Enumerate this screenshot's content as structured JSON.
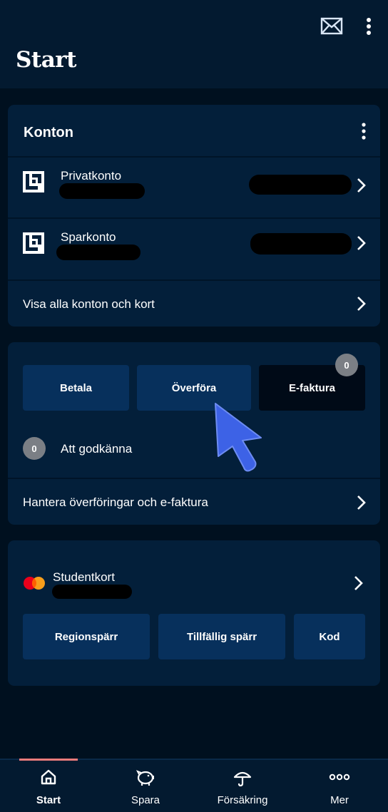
{
  "header": {
    "title": "Start",
    "mail_icon": "mail-icon",
    "more_icon": "more-vertical-icon"
  },
  "accounts_card": {
    "title": "Konton",
    "menu_icon": "more-vertical-icon",
    "accounts": [
      {
        "name": "Privatkonto",
        "icon": "bank-logo-icon"
      },
      {
        "name": "Sparkonto",
        "icon": "bank-logo-icon"
      }
    ],
    "show_all_label": "Visa alla konton och kort"
  },
  "payments_card": {
    "buttons": [
      {
        "label": "Betala"
      },
      {
        "label": "Överföra"
      },
      {
        "label": "E-faktura",
        "badge": "0"
      }
    ],
    "approve_badge": "0",
    "approve_label": "Att godkänna",
    "manage_label": "Hantera överföringar och e-faktura"
  },
  "card_section": {
    "card_name": "Studentkort",
    "card_icon": "mastercard-icon",
    "buttons": [
      {
        "label": "Regionspärr"
      },
      {
        "label": "Tillfällig spärr"
      },
      {
        "label": "Kod"
      }
    ]
  },
  "bottom_nav": {
    "items": [
      {
        "label": "Start",
        "icon": "home-icon",
        "active": true
      },
      {
        "label": "Spara",
        "icon": "piggy-bank-icon",
        "active": false
      },
      {
        "label": "Försäkring",
        "icon": "umbrella-icon",
        "active": false
      },
      {
        "label": "Mer",
        "icon": "more-horizontal-icon",
        "active": false
      }
    ]
  },
  "colors": {
    "background": "#00101f",
    "card": "#031f3a",
    "button": "#07305c",
    "active_indicator": "#ec7b7b",
    "pointer": "#3d62e6"
  }
}
